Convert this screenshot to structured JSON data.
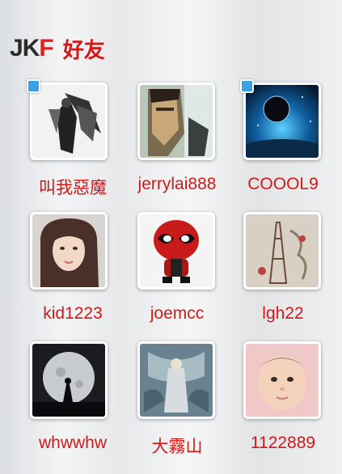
{
  "header": {
    "logo_j": "J",
    "logo_k": "K",
    "logo_f": "F",
    "title": "好友"
  },
  "friends": [
    {
      "name": "叫我惡魔",
      "online": true,
      "avatar": "dark-angel-image"
    },
    {
      "name": "jerrylai888",
      "online": false,
      "avatar": "man-face-image"
    },
    {
      "name": "COOOL9",
      "online": true,
      "avatar": "planet-space-image"
    },
    {
      "name": "kid1223",
      "online": false,
      "avatar": "girl-portrait-image"
    },
    {
      "name": "joemcc",
      "online": false,
      "avatar": "deadpool-figure-image"
    },
    {
      "name": "lgh22",
      "online": false,
      "avatar": "tower-sketch-image"
    },
    {
      "name": "whwwhw",
      "online": false,
      "avatar": "moon-silhouette-image"
    },
    {
      "name": "大霧山",
      "online": false,
      "avatar": "fantasy-art-image"
    },
    {
      "name": "1122889",
      "online": false,
      "avatar": "baby-photo-image"
    }
  ],
  "colors": {
    "accent": "#d41818",
    "online_badge": "#3aa0e8"
  }
}
